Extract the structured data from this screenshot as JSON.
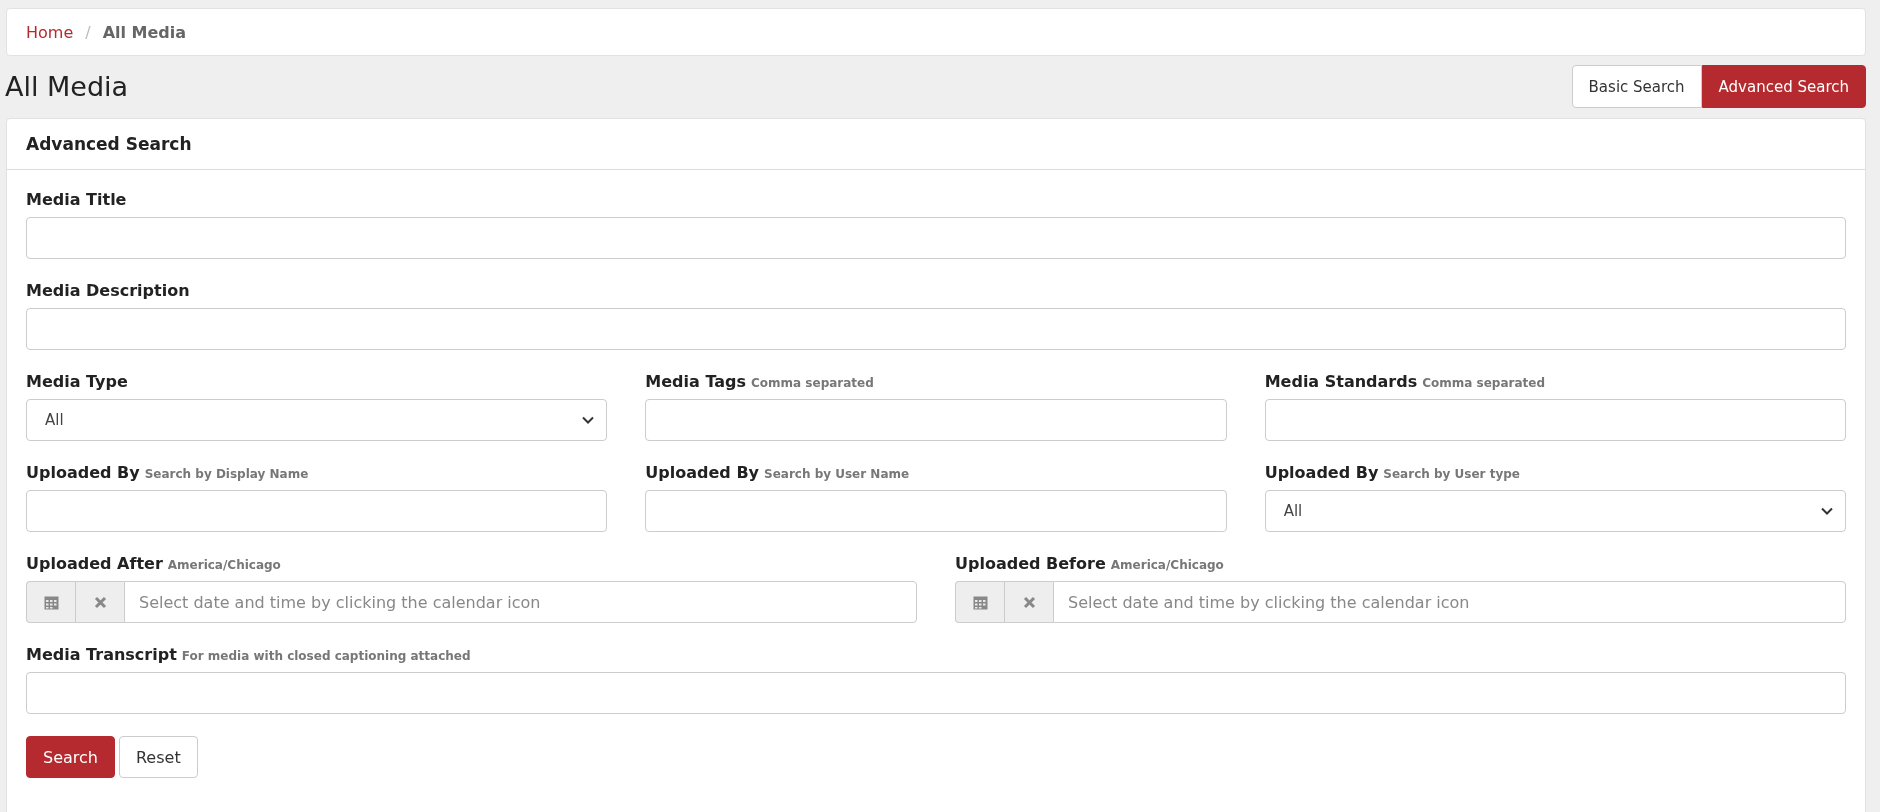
{
  "breadcrumb": [
    {
      "label": "Home",
      "current": false
    },
    {
      "label": "All Media",
      "current": true
    }
  ],
  "breadcrumb_separator": "/",
  "page_title": "All Media",
  "search_modes": [
    {
      "label": "Basic Search",
      "selected": false
    },
    {
      "label": "Advanced Search",
      "selected": true
    }
  ],
  "panel": {
    "title": "Advanced Search",
    "rows": [
      {
        "fields": [
          {
            "kind": "text",
            "label": "Media Title"
          }
        ]
      },
      {
        "fields": [
          {
            "kind": "text",
            "label": "Media Description"
          }
        ]
      },
      {
        "fields": [
          {
            "kind": "select",
            "label": "Media Type",
            "value": "All"
          },
          {
            "kind": "text",
            "label": "Media Tags",
            "hint": "Comma separated"
          },
          {
            "kind": "text",
            "label": "Media Standards",
            "hint": "Comma separated"
          }
        ]
      },
      {
        "fields": [
          {
            "kind": "text",
            "label": "Uploaded By",
            "hint": "Search by Display Name"
          },
          {
            "kind": "text",
            "label": "Uploaded By",
            "hint": "Search by User Name"
          },
          {
            "kind": "select",
            "label": "Uploaded By",
            "hint": "Search by User type",
            "value": "All"
          }
        ]
      },
      {
        "fields": [
          {
            "kind": "datetime",
            "label": "Uploaded After",
            "hint": "America/Chicago",
            "placeholder": "Select date and time by clicking the calendar icon"
          },
          {
            "kind": "datetime",
            "label": "Uploaded Before",
            "hint": "America/Chicago",
            "placeholder": "Select date and time by clicking the calendar icon"
          }
        ]
      },
      {
        "fields": [
          {
            "kind": "text",
            "label": "Media Transcript",
            "hint": "For media with closed captioning attached"
          }
        ]
      }
    ],
    "buttons": [
      {
        "label": "Search",
        "kind": "primary"
      },
      {
        "label": "Reset",
        "kind": "secondary"
      }
    ]
  }
}
